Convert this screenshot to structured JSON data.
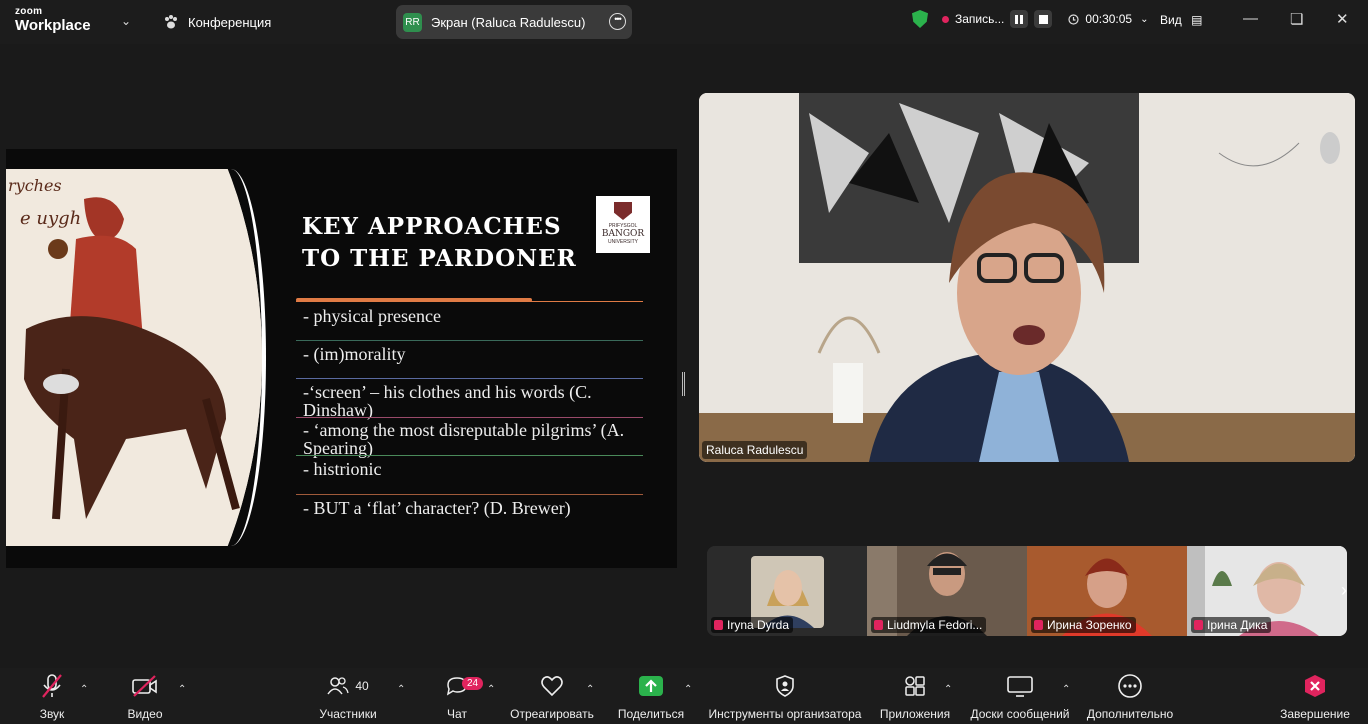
{
  "app": {
    "logo_top": "zoom",
    "logo_bottom": "Workplace",
    "meeting_label": "Конференция"
  },
  "share": {
    "initials": "RR",
    "label": "Экран (Raluca Radulescu)"
  },
  "status": {
    "record_label": "Запись...",
    "timer": "00:30:05",
    "view_label": "Вид"
  },
  "slide": {
    "title_line1": "KEY APPROACHES",
    "title_line2": "TO THE PARDONER",
    "logo_text1": "PRIFYSGOL",
    "logo_text2": "BANGOR",
    "logo_text3": "UNIVERSITY",
    "bullets": [
      "- physical presence",
      "- (im)morality",
      "-‘screen’ – his clothes and his words (C. Dinshaw)",
      "- ‘among the most disreputable pilgrims’ (A. Spearing)",
      "- histrionic",
      "- BUT a ‘flat’ character? (D. Brewer)"
    ]
  },
  "speaker": {
    "name": "Raluca Radulescu"
  },
  "participants": [
    {
      "name": "Iryna Dyrda"
    },
    {
      "name": "Liudmyla Fedori..."
    },
    {
      "name": "Ирина Зоренко"
    },
    {
      "name": "Ірина Дика"
    }
  ],
  "toolbar": {
    "audio": "Звук",
    "video": "Видео",
    "participants": "Участники",
    "participants_count": "40",
    "chat": "Чат",
    "chat_badge": "24",
    "react": "Отреагировать",
    "share": "Поделиться",
    "host_tools": "Инструменты организатора",
    "apps": "Приложения",
    "whiteboards": "Доски сообщений",
    "more": "Дополнительно",
    "end": "Завершение"
  },
  "colors": {
    "share_green": "#2bb24c",
    "end_red": "#e0245e",
    "accent_orange": "#e07b45"
  }
}
